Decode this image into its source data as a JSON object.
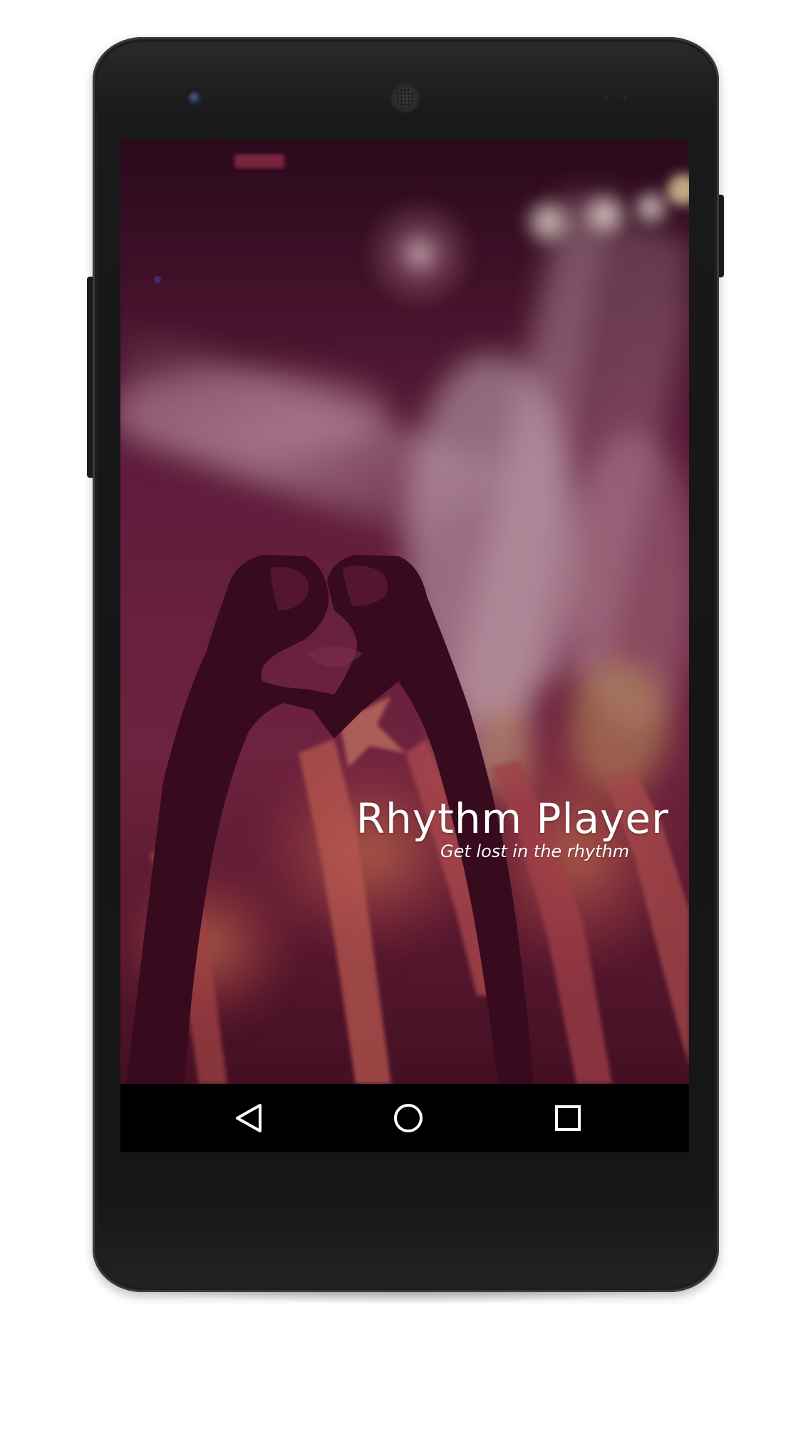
{
  "app": {
    "title": "Rhythm Player",
    "tagline": "Get lost in the rhythm"
  },
  "device": {
    "frame_color": "#161616",
    "screen_tint": "#7a1f45"
  },
  "navbar": {
    "back_icon": "back-triangle-icon",
    "home_icon": "home-circle-icon",
    "recent_icon": "recent-square-icon"
  },
  "hero_image": {
    "subject": "concert-crowd-heart-hands-icon"
  }
}
